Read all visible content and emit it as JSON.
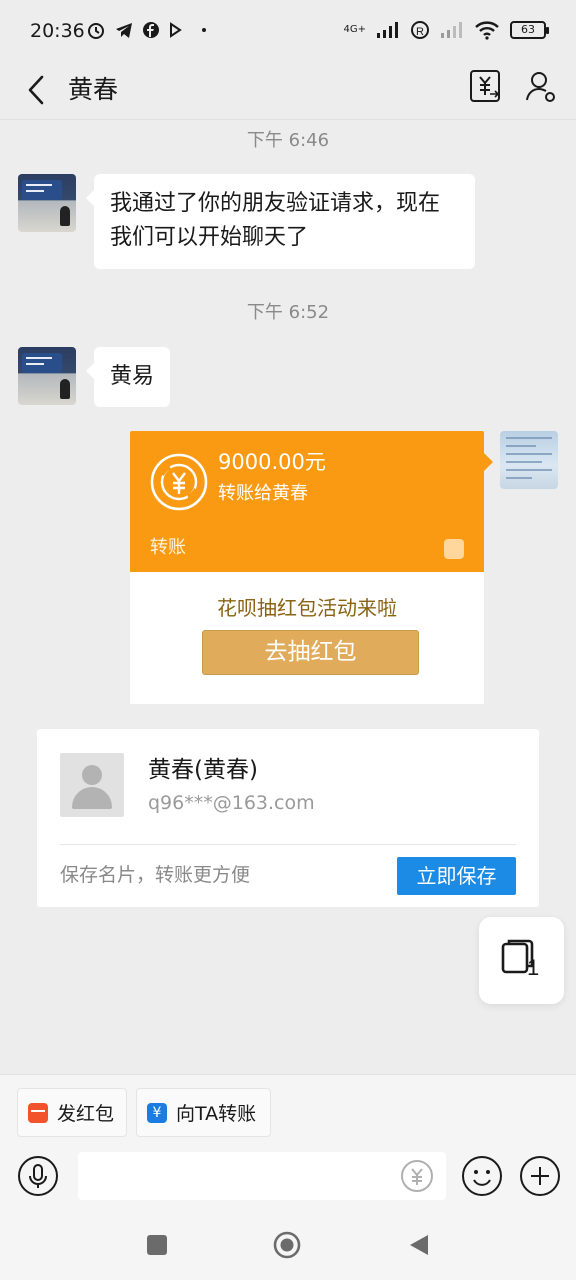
{
  "status_bar": {
    "time": "20:36",
    "network": "4G+",
    "battery": "63"
  },
  "header": {
    "title": "黄春",
    "back_icon": "chevron-left-icon",
    "transfer_icon": "yen-transfer-icon",
    "profile_icon": "person-settings-icon"
  },
  "messages": [
    {
      "timestamp": "下午 6:46",
      "text": "我通过了你的朋友验证请求，现在我们可以开始聊天了"
    },
    {
      "timestamp": "下午 6:52",
      "text": "黄易"
    }
  ],
  "transfer_card": {
    "amount": "9000.00元",
    "recipient_line": "转账给黄春",
    "label": "转账",
    "promo": "花呗抽红包活动来啦",
    "button": "去抽红包",
    "accent_color": "#fa9a13"
  },
  "contact_card": {
    "name": "黄春(黄春)",
    "email": "q96***@163.com",
    "hint": "保存名片，转账更方便",
    "button": "立即保存",
    "button_color": "#1b8be5"
  },
  "floating_button": {
    "count": "1",
    "icon": "window-stack-icon"
  },
  "quick_actions": [
    {
      "label": "发红包",
      "icon": "red-envelope-icon"
    },
    {
      "label": "向TA转账",
      "icon": "yen-icon"
    }
  ],
  "input_bar": {
    "placeholder": "",
    "voice_icon": "mic-icon",
    "emoji_icon": "smile-icon",
    "more_icon": "plus-icon"
  }
}
